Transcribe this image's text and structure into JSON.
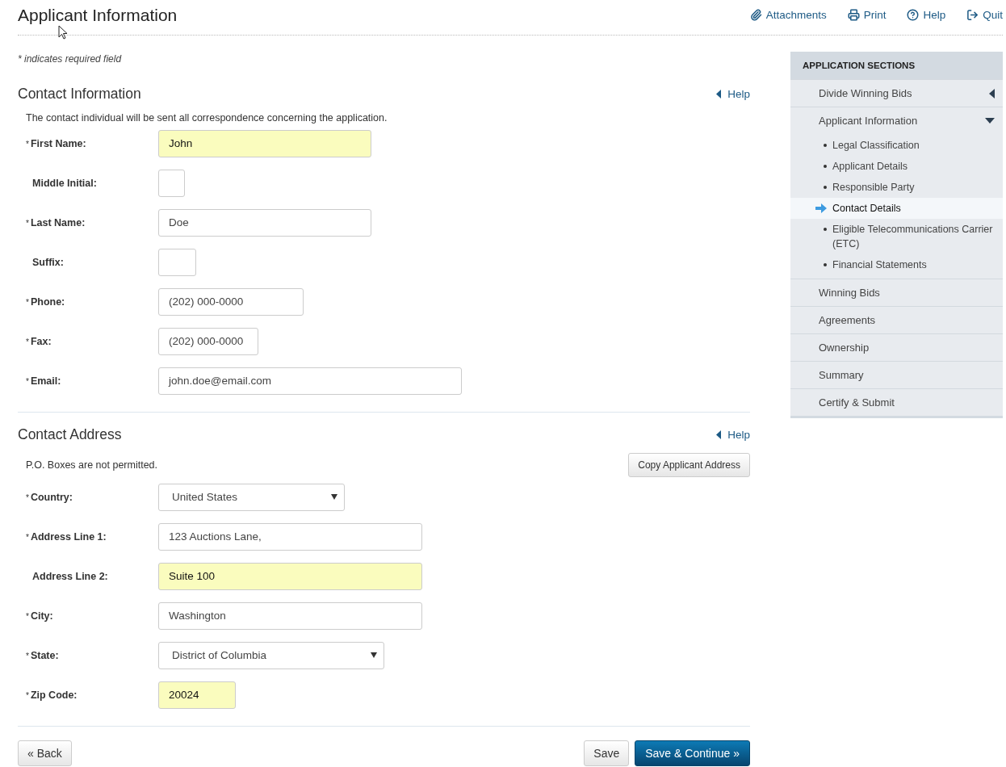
{
  "header": {
    "title": "Applicant Information",
    "links": [
      {
        "kind": "attachments",
        "label": "Attachments"
      },
      {
        "kind": "print",
        "label": "Print"
      },
      {
        "kind": "help",
        "label": "Help"
      },
      {
        "kind": "quit",
        "label": "Quit"
      }
    ]
  },
  "required_note": "* indicates required field",
  "sections": [
    {
      "title": "Contact Information",
      "help": "Help",
      "note": "The contact individual will be sent all correspondence concerning the application.",
      "fields": [
        {
          "mark": "*",
          "label": "First Name:",
          "kind": "text",
          "value": "John",
          "highlighted": true
        },
        {
          "label": "Middle Initial:",
          "kind": "text",
          "highlighted": false
        },
        {
          "mark": "*",
          "label": "Last Name:",
          "kind": "text",
          "value": "Doe",
          "highlighted": false
        },
        {
          "label": "Suffix:",
          "kind": "text",
          "highlighted": false
        },
        {
          "mark": "*",
          "label": "Phone:",
          "kind": "text",
          "value": "(202) 000-0000",
          "highlighted": false
        },
        {
          "mark": "*",
          "label": "Fax:",
          "kind": "text",
          "value": "(202) 000-0000",
          "highlighted": false
        },
        {
          "mark": "*",
          "label": "Email:",
          "kind": "text",
          "value": "john.doe@email.com",
          "highlighted": false
        }
      ]
    },
    {
      "title": "Contact Address",
      "help": "Help",
      "note": "P.O. Boxes are not permitted.",
      "action": "Copy Applicant Address",
      "fields": [
        {
          "mark": "*",
          "label": "Country:",
          "kind": "select",
          "value": "United States",
          "highlighted": false
        },
        {
          "mark": "*",
          "label": "Address Line 1:",
          "kind": "text",
          "value": "123 Auctions Lane,",
          "highlighted": false
        },
        {
          "label": "Address Line 2:",
          "kind": "text",
          "value": "Suite 100",
          "highlighted": true
        },
        {
          "mark": "*",
          "label": "City:",
          "kind": "text",
          "value": "Washington",
          "highlighted": false
        },
        {
          "mark": "*",
          "label": "State:",
          "kind": "select",
          "value": "District of Columbia",
          "highlighted": false
        },
        {
          "mark": "*",
          "label": "Zip Code:",
          "kind": "text",
          "value": "20024",
          "highlighted": true
        }
      ]
    }
  ],
  "footer": {
    "back": "« Back",
    "save": "Save",
    "continue": "Save & Continue »"
  },
  "sidebar": {
    "title": "APPLICATION SECTIONS",
    "items": [
      {
        "label": "Divide Winning Bids",
        "kind": "group",
        "expanded": false
      },
      {
        "label": "Applicant Information",
        "kind": "group",
        "expanded": true,
        "children": [
          {
            "label": "Legal Classification",
            "selected": false
          },
          {
            "label": "Applicant Details",
            "selected": false
          },
          {
            "label": "Responsible Party",
            "selected": false
          },
          {
            "label": "Contact Details",
            "selected": true
          },
          {
            "label": "Eligible Telecommunications Carrier (ETC)",
            "selected": false
          },
          {
            "label": "Financial Statements",
            "selected": false
          }
        ]
      },
      {
        "label": "Winning Bids",
        "kind": "link"
      },
      {
        "label": "Agreements",
        "kind": "link"
      },
      {
        "label": "Ownership",
        "kind": "link"
      },
      {
        "label": "Summary",
        "kind": "link"
      },
      {
        "label": "Certify & Submit",
        "kind": "link"
      }
    ]
  }
}
